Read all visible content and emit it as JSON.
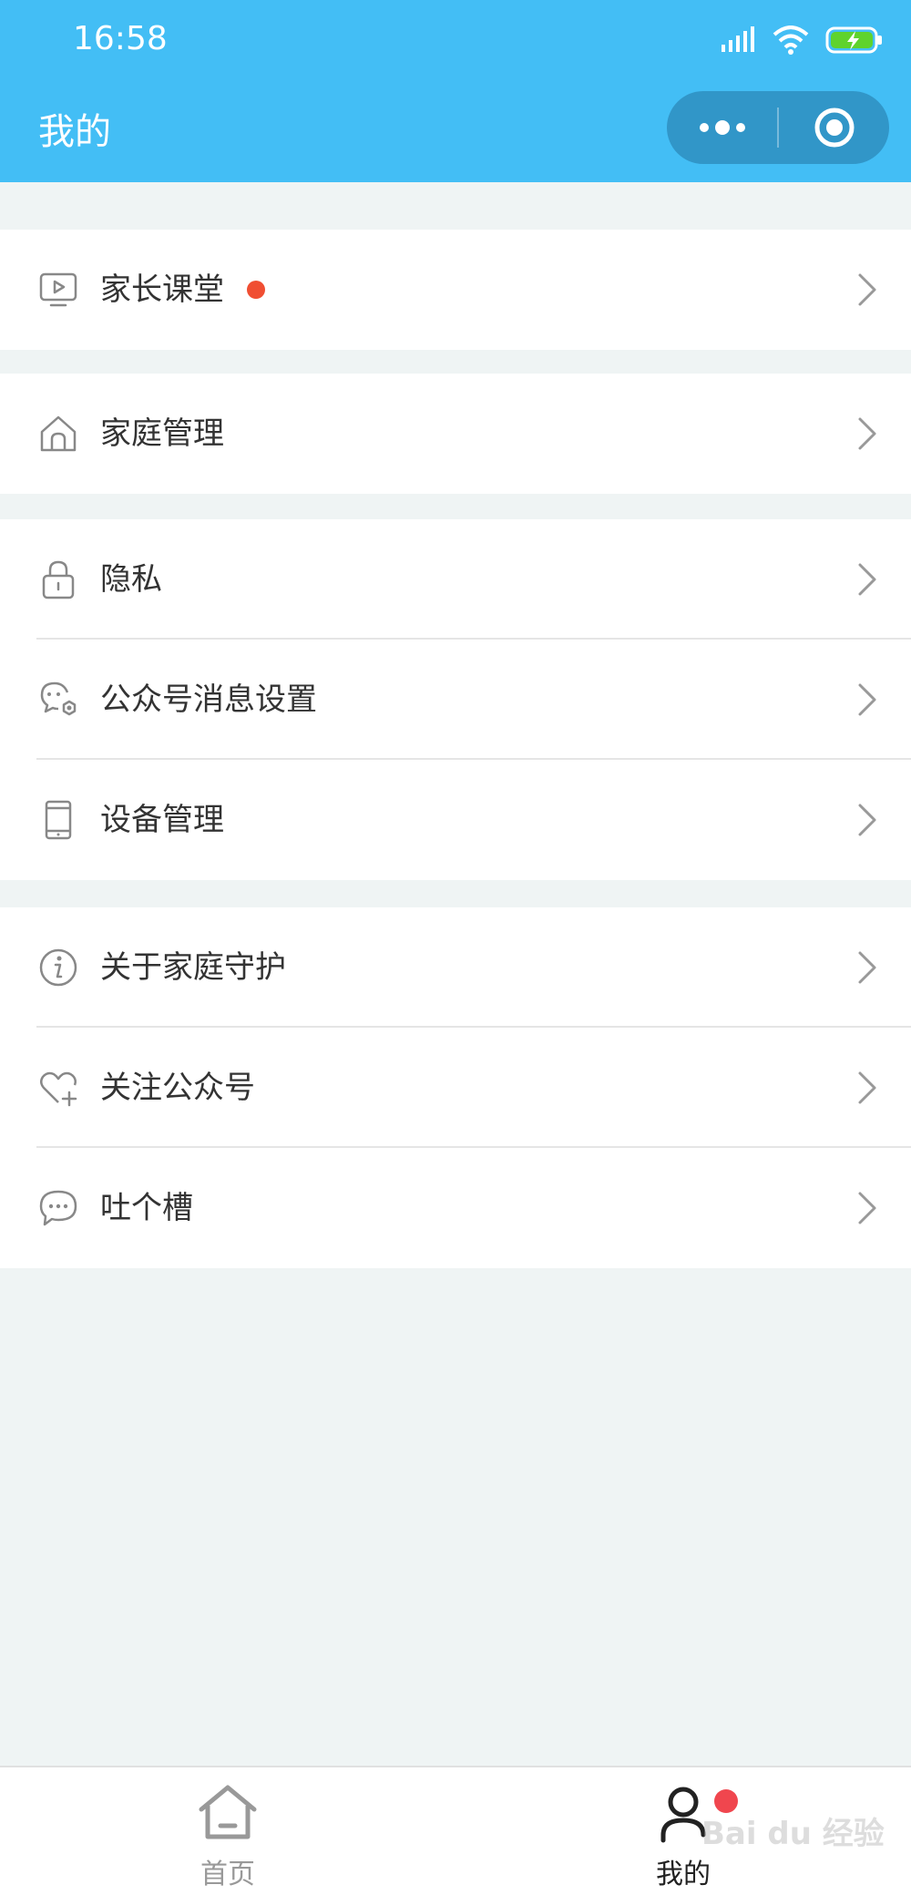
{
  "status_bar": {
    "time": "16:58"
  },
  "header": {
    "title": "我的"
  },
  "capsule": {
    "more_icon": "more-dots-icon",
    "close_icon": "target-circle-icon"
  },
  "sections": [
    {
      "items": [
        {
          "label": "家长课堂",
          "icon": "play-screen-icon",
          "badge": true
        }
      ]
    },
    {
      "items": [
        {
          "label": "家庭管理",
          "icon": "home-icon"
        }
      ]
    },
    {
      "items": [
        {
          "label": "隐私",
          "icon": "lock-icon"
        },
        {
          "label": "公众号消息设置",
          "icon": "chat-settings-icon"
        },
        {
          "label": "设备管理",
          "icon": "phone-device-icon"
        }
      ]
    },
    {
      "items": [
        {
          "label": "关于家庭守护",
          "icon": "info-icon"
        },
        {
          "label": "关注公众号",
          "icon": "heart-plus-icon"
        },
        {
          "label": "吐个槽",
          "icon": "chat-bubble-icon"
        }
      ]
    }
  ],
  "tabbar": {
    "tabs": [
      {
        "label": "首页",
        "icon": "home-tab-icon",
        "active": false
      },
      {
        "label": "我的",
        "icon": "user-tab-icon",
        "active": true,
        "badge": true
      }
    ]
  },
  "watermark": "Bai du 经验",
  "colors": {
    "header": "#43bef5",
    "accent_dot": "#f04e32",
    "background": "#eff4f4"
  }
}
